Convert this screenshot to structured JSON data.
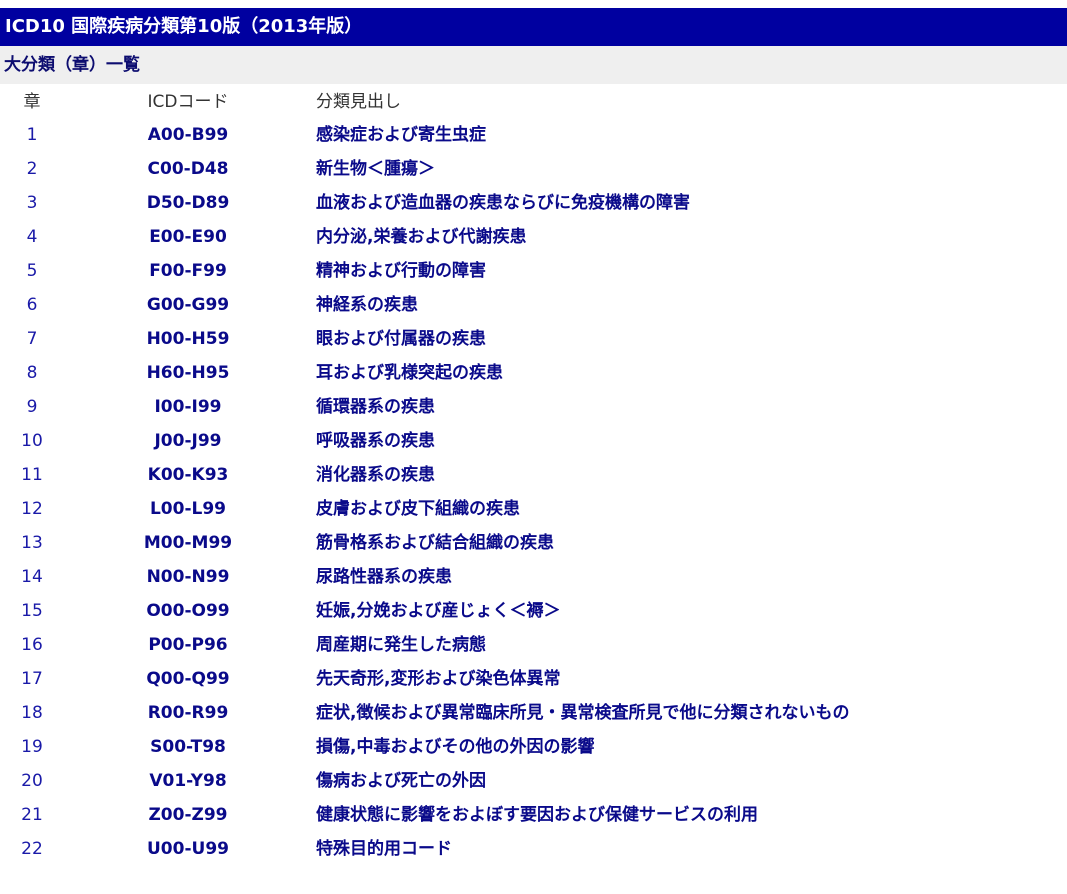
{
  "title": "ICD10 国際疾病分類第10版（2013年版）",
  "subtitle": "大分類（章）一覧",
  "headers": {
    "chapter": "章",
    "code": "ICDコード",
    "heading": "分類見出し"
  },
  "rows": [
    {
      "chapter": "1",
      "code": "A00-B99",
      "name": "感染症および寄生虫症"
    },
    {
      "chapter": "2",
      "code": "C00-D48",
      "name": "新生物＜腫瘍＞"
    },
    {
      "chapter": "3",
      "code": "D50-D89",
      "name": "血液および造血器の疾患ならびに免疫機構の障害"
    },
    {
      "chapter": "4",
      "code": "E00-E90",
      "name": "内分泌,栄養および代謝疾患"
    },
    {
      "chapter": "5",
      "code": "F00-F99",
      "name": "精神および行動の障害"
    },
    {
      "chapter": "6",
      "code": "G00-G99",
      "name": "神経系の疾患"
    },
    {
      "chapter": "7",
      "code": "H00-H59",
      "name": "眼および付属器の疾患"
    },
    {
      "chapter": "8",
      "code": "H60-H95",
      "name": "耳および乳様突起の疾患"
    },
    {
      "chapter": "9",
      "code": "I00-I99",
      "name": "循環器系の疾患"
    },
    {
      "chapter": "10",
      "code": "J00-J99",
      "name": "呼吸器系の疾患"
    },
    {
      "chapter": "11",
      "code": "K00-K93",
      "name": "消化器系の疾患"
    },
    {
      "chapter": "12",
      "code": "L00-L99",
      "name": "皮膚および皮下組織の疾患"
    },
    {
      "chapter": "13",
      "code": "M00-M99",
      "name": "筋骨格系および結合組織の疾患"
    },
    {
      "chapter": "14",
      "code": "N00-N99",
      "name": "尿路性器系の疾患"
    },
    {
      "chapter": "15",
      "code": "O00-O99",
      "name": "妊娠,分娩および産じょく＜褥＞"
    },
    {
      "chapter": "16",
      "code": "P00-P96",
      "name": "周産期に発生した病態"
    },
    {
      "chapter": "17",
      "code": "Q00-Q99",
      "name": "先天奇形,変形および染色体異常"
    },
    {
      "chapter": "18",
      "code": "R00-R99",
      "name": "症状,徴候および異常臨床所見・異常検査所見で他に分類されないもの"
    },
    {
      "chapter": "19",
      "code": "S00-T98",
      "name": "損傷,中毒およびその他の外因の影響"
    },
    {
      "chapter": "20",
      "code": "V01-Y98",
      "name": "傷病および死亡の外因"
    },
    {
      "chapter": "21",
      "code": "Z00-Z99",
      "name": "健康状態に影響をおよぼす要因および保健サービスの利用"
    },
    {
      "chapter": "22",
      "code": "U00-U99",
      "name": "特殊目的用コード"
    }
  ]
}
